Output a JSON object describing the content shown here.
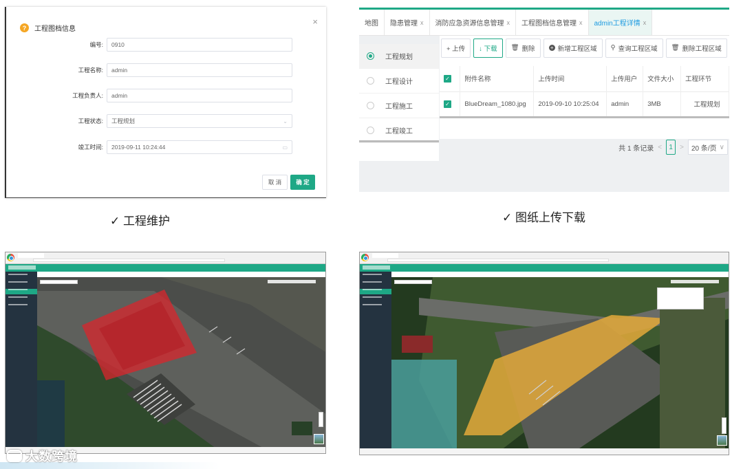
{
  "dialog": {
    "title": "工程图档信息",
    "close": "×",
    "fields": [
      {
        "label": "编号:",
        "value": "0910",
        "suffix": ""
      },
      {
        "label": "工程名称:",
        "value": "admin",
        "suffix": ""
      },
      {
        "label": "工程负责人:",
        "value": "admin",
        "suffix": ""
      },
      {
        "label": "工程状态:",
        "value": "工程规划",
        "suffix": "⌄"
      },
      {
        "label": "竣工时间:",
        "value": "2019-09-11 10:24:44",
        "suffix": "▭"
      }
    ],
    "cancel": "取 消",
    "ok": "确 定"
  },
  "upload": {
    "tabs": [
      {
        "label": "地图",
        "close": ""
      },
      {
        "label": "隐患管理",
        "close": "x"
      },
      {
        "label": "消防应急资源信息管理",
        "close": "x"
      },
      {
        "label": "工程图档信息管理",
        "close": "x"
      },
      {
        "label": "admin工程详情",
        "close": "x"
      }
    ],
    "stages": [
      "工程规划",
      "工程设计",
      "工程施工",
      "工程竣工"
    ],
    "toolbar": {
      "upload": "+ 上传",
      "download": "↓ 下载",
      "delete": "删除",
      "add_area": "新增工程区域",
      "query_area": "查询工程区域",
      "delete_area": "删除工程区域"
    },
    "columns": [
      "附件名称",
      "上传时间",
      "上传用户",
      "文件大小",
      "工程环节"
    ],
    "rows": [
      {
        "name": "BlueDream_1080.jpg",
        "time": "2019-09-10 10:25:04",
        "user": "admin",
        "size": "3MB",
        "stage": "工程规划"
      }
    ],
    "pager": {
      "total": "共 1 条记录",
      "prev": "<",
      "page": "1",
      "next": ">",
      "size": "20 条/页",
      "size_arrow": "∨"
    }
  },
  "captions": {
    "left": "✓ 工程维护",
    "right": "✓ 图纸上传下载"
  },
  "watermark": "大数跨境",
  "colors": {
    "accent": "#1ea886",
    "tab_active": "#1e9be0",
    "warning": "#f5a623",
    "area_red": "#d9262c",
    "area_yellow": "#e3a93a"
  }
}
